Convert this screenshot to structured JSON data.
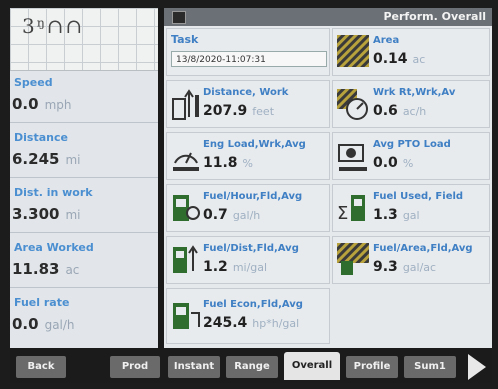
{
  "header": {
    "title": "Perform. Overall"
  },
  "map": {
    "marks": "3ᵑ∩∩"
  },
  "left_metrics": [
    {
      "label": "Speed",
      "value": "0.0",
      "unit": "mph"
    },
    {
      "label": "Distance",
      "value": "6.245",
      "unit": "mi"
    },
    {
      "label": "Dist. in work",
      "value": "3.300",
      "unit": "mi"
    },
    {
      "label": "Area Worked",
      "value": "11.83",
      "unit": "ac"
    },
    {
      "label": "Fuel rate",
      "value": "0.0",
      "unit": "gal/h"
    }
  ],
  "task": {
    "label": "Task",
    "value": "13/8/2020-11:07:31"
  },
  "area": {
    "label": "Area",
    "value": "0.14",
    "unit": "ac"
  },
  "tiles": [
    {
      "label": "Distance, Work",
      "value": "207.9",
      "unit": "feet",
      "icon": "distance-work-icon"
    },
    {
      "label": "Wrk Rt,Wrk,Av",
      "value": "0.6",
      "unit": "ac/h",
      "icon": "work-rate-icon"
    },
    {
      "label": "Eng Load,Wrk,Avg",
      "value": "11.8",
      "unit": "%",
      "icon": "engine-load-icon"
    },
    {
      "label": "Avg PTO Load",
      "value": "0.0",
      "unit": "%",
      "icon": "pto-load-icon"
    },
    {
      "label": "Fuel/Hour,Fld,Avg",
      "value": "0.7",
      "unit": "gal/h",
      "icon": "fuel-hour-icon"
    },
    {
      "label": "Fuel Used, Field",
      "value": "1.3",
      "unit": "gal",
      "icon": "fuel-used-icon"
    },
    {
      "label": "Fuel/Dist,Fld,Avg",
      "value": "1.2",
      "unit": "mi/gal",
      "icon": "fuel-distance-icon"
    },
    {
      "label": "Fuel/Area,Fld,Avg",
      "value": "9.3",
      "unit": "gal/ac",
      "icon": "fuel-area-icon"
    },
    {
      "label": "Fuel Econ,Fld,Avg",
      "value": "245.4",
      "unit": "hp*h/gal",
      "icon": "fuel-econ-icon"
    }
  ],
  "tabs": {
    "back": "Back",
    "prod": "Prod",
    "instant": "Instant",
    "range": "Range",
    "overall": "Overall",
    "profile": "Profile",
    "sum": "Sum1"
  },
  "colors": {
    "label_blue": "#3f7fc4",
    "header_gray": "#6b7076",
    "tab_dark": "#1b1b1b"
  }
}
